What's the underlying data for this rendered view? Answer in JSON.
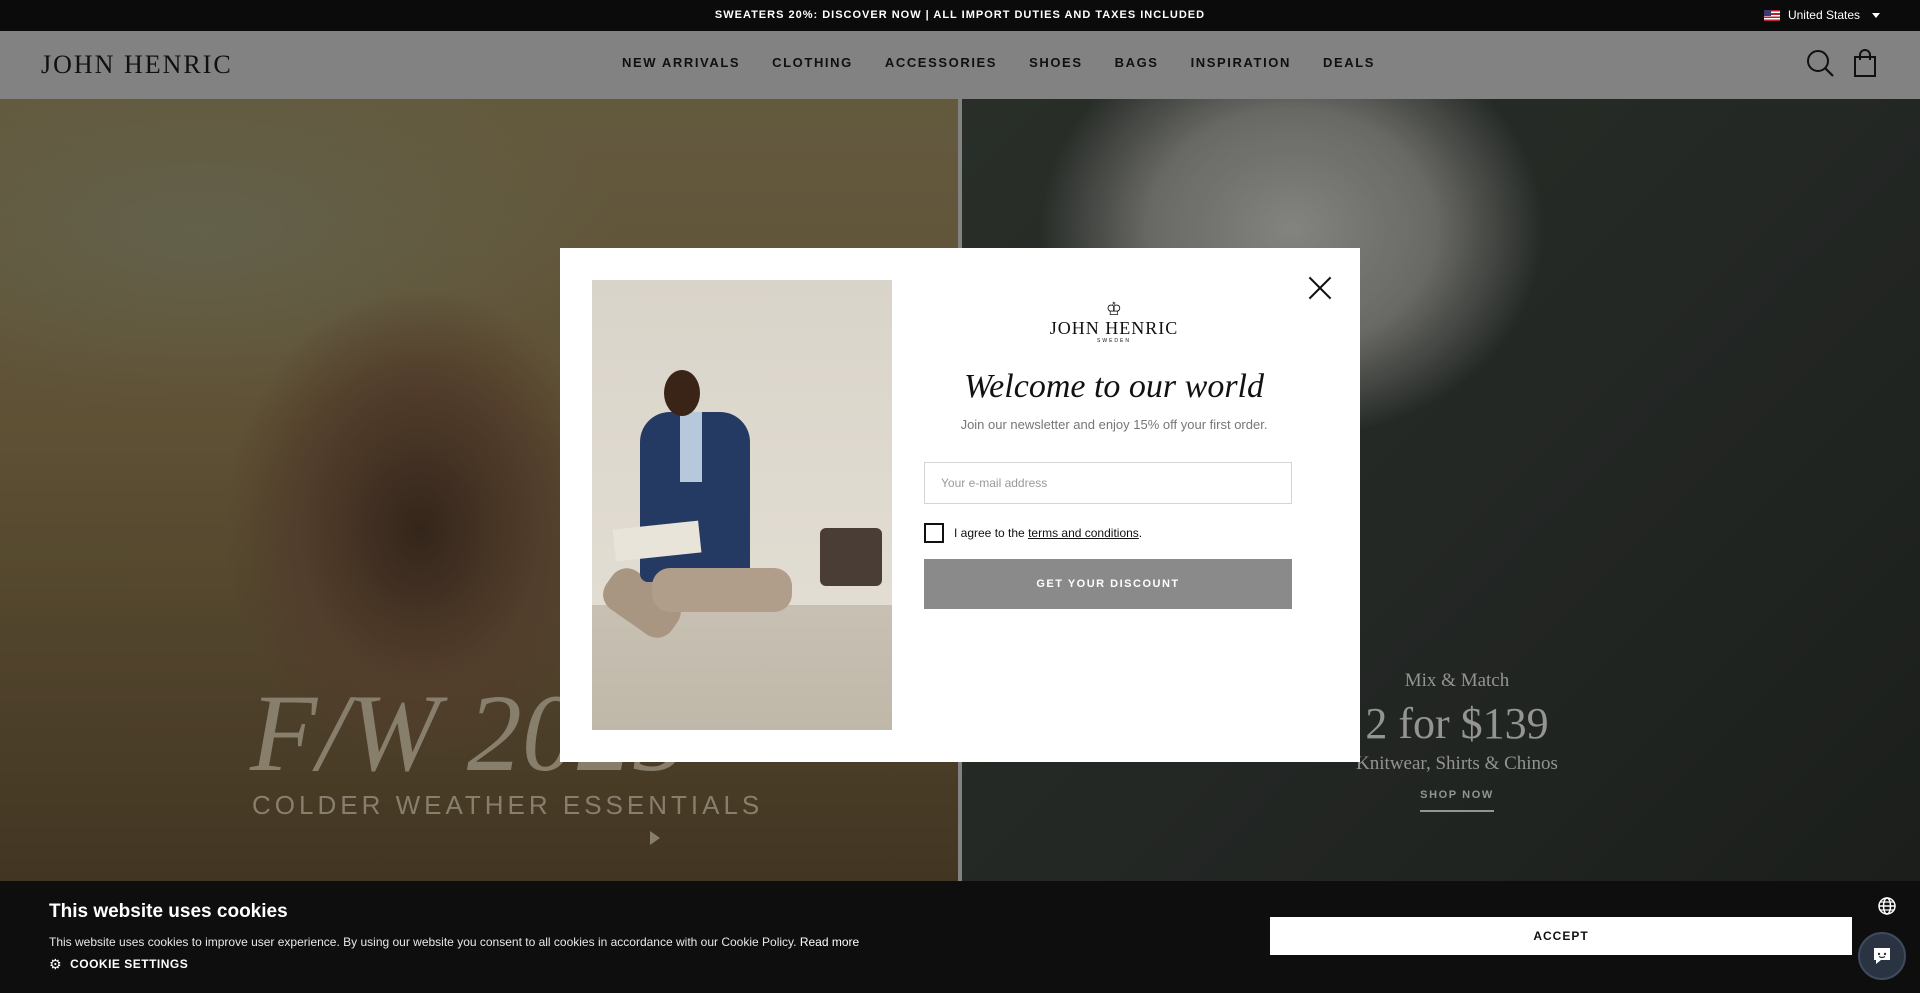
{
  "announcement": {
    "text": "SWEATERS 20%: DISCOVER NOW | ALL IMPORT DUTIES AND TAXES INCLUDED"
  },
  "country_selector": {
    "label": "United States",
    "flag": "us-flag-icon"
  },
  "header": {
    "logo": "JOHN HENRIC",
    "nav": [
      {
        "label": "NEW ARRIVALS"
      },
      {
        "label": "CLOTHING"
      },
      {
        "label": "ACCESSORIES"
      },
      {
        "label": "SHOES"
      },
      {
        "label": "BAGS"
      },
      {
        "label": "INSPIRATION"
      },
      {
        "label": "DEALS"
      }
    ],
    "icons": [
      "search-icon",
      "bag-icon"
    ]
  },
  "hero_left": {
    "title": "F/W 2025",
    "subtitle": "COLDER WEATHER ESSENTIALS"
  },
  "hero_right": {
    "kicker": "Mix & Match",
    "headline": "2 for $139",
    "subline": "Knitwear, Shirts & Chinos",
    "cta": "SHOP NOW"
  },
  "modal": {
    "brand": "JOHN HENRIC",
    "brand_sub": "SWEDEN",
    "heading": "Welcome to our world",
    "subheading": "Join our newsletter and enjoy 15% off your first order.",
    "email_placeholder": "Your e-mail address",
    "email_value": "",
    "agree_prefix": "I agree to the ",
    "agree_link": "terms and conditions",
    "agree_suffix": ".",
    "checkbox_checked": false,
    "button": "GET YOUR DISCOUNT"
  },
  "cookie": {
    "title": "This website uses cookies",
    "text": "This website uses cookies to improve user experience. By using our website you consent to all cookies in accordance with our Cookie Policy.",
    "read_more": "Read more",
    "settings": "COOKIE SETTINGS",
    "accept": "ACCEPT"
  },
  "colors": {
    "header_bg": "#8a8a8a",
    "announce_bg": "#0b0b0b",
    "button_bg": "#8a8a8a",
    "cookie_bg": "#0e0e0e"
  }
}
